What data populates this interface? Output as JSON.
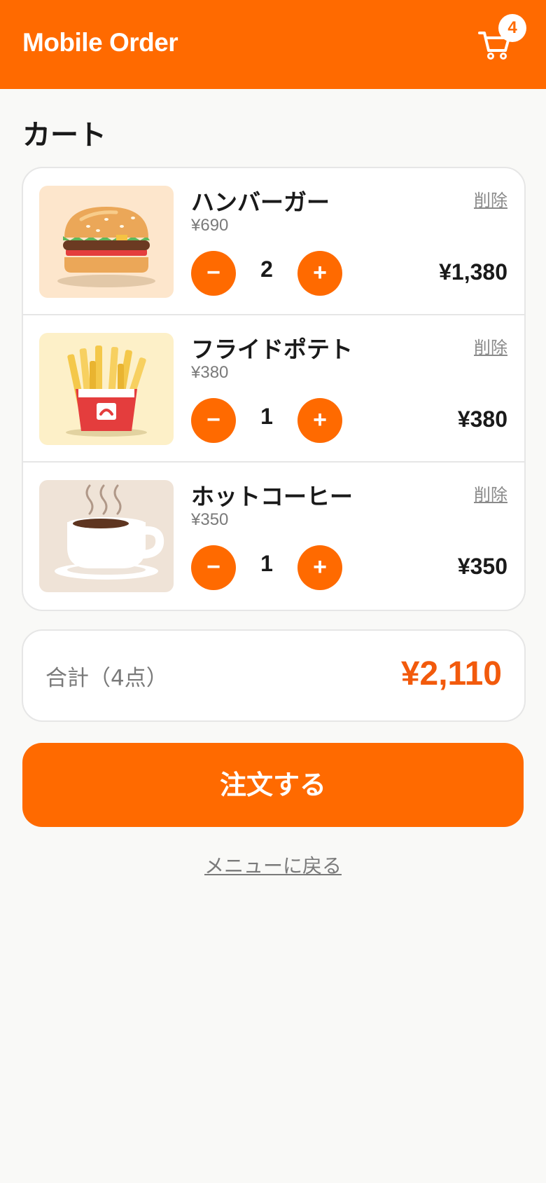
{
  "header": {
    "title": "Mobile Order",
    "cart_icon": "cart-icon",
    "cart_count": "4"
  },
  "page": {
    "title": "カート"
  },
  "cart": {
    "remove_label": "削除",
    "minus_label": "−",
    "plus_label": "+",
    "items": [
      {
        "name": "ハンバーガー",
        "unit_price": "¥690",
        "quantity": "2",
        "line_total": "¥1,380",
        "image": "hamburger-image"
      },
      {
        "name": "フライドポテト",
        "unit_price": "¥380",
        "quantity": "1",
        "line_total": "¥380",
        "image": "french-fries-image"
      },
      {
        "name": "ホットコーヒー",
        "unit_price": "¥350",
        "quantity": "1",
        "line_total": "¥350",
        "image": "hot-coffee-image"
      }
    ]
  },
  "summary": {
    "label": "合計（4点）",
    "total": "¥2,110"
  },
  "actions": {
    "order_label": "注文する",
    "back_label": "メニューに戻る"
  },
  "colors": {
    "accent": "#ff6a00",
    "total_text": "#f25a0c",
    "muted_text": "#7a7a7a",
    "background": "#f9f9f7"
  }
}
